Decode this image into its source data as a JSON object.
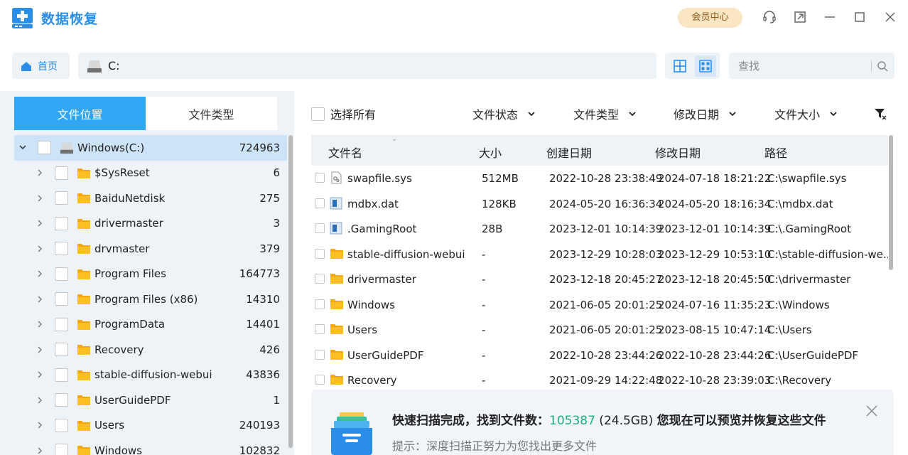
{
  "app": {
    "title": "数据恢复",
    "vip_label": "会员中心"
  },
  "nav": {
    "home_label": "首页",
    "path": "C:",
    "search_placeholder": "查找"
  },
  "left": {
    "tabs": [
      {
        "label": "文件位置",
        "active": true
      },
      {
        "label": "文件类型",
        "active": false
      }
    ],
    "tree": [
      {
        "name": "Windows(C:)",
        "count": "724963",
        "type": "drive",
        "expanded": true
      },
      {
        "name": "$SysReset",
        "count": "6",
        "type": "folder"
      },
      {
        "name": "BaiduNetdisk",
        "count": "275",
        "type": "folder"
      },
      {
        "name": "drivermaster",
        "count": "3",
        "type": "folder"
      },
      {
        "name": "drvmaster",
        "count": "379",
        "type": "folder"
      },
      {
        "name": "Program Files",
        "count": "164773",
        "type": "folder"
      },
      {
        "name": "Program Files (x86)",
        "count": "14310",
        "type": "folder"
      },
      {
        "name": "ProgramData",
        "count": "14401",
        "type": "folder"
      },
      {
        "name": "Recovery",
        "count": "426",
        "type": "folder"
      },
      {
        "name": "stable-diffusion-webui",
        "count": "43836",
        "type": "folder"
      },
      {
        "name": "UserGuidePDF",
        "count": "1",
        "type": "folder"
      },
      {
        "name": "Users",
        "count": "240193",
        "type": "folder"
      },
      {
        "name": "Windows",
        "count": "102832",
        "type": "folder"
      }
    ]
  },
  "filters": {
    "select_all": "选择所有",
    "status": "文件状态",
    "type": "文件类型",
    "modified": "修改日期",
    "size": "文件大小"
  },
  "table": {
    "headers": {
      "name": "文件名",
      "size": "大小",
      "created": "创建日期",
      "modified": "修改日期",
      "path": "路径"
    },
    "rows": [
      {
        "name": "swapfile.sys",
        "size": "512MB",
        "created": "2022-10-28 23:38:49",
        "modified": "2024-07-18 18:21:22",
        "path": "C:\\swapfile.sys",
        "icon": "sys"
      },
      {
        "name": "mdbx.dat",
        "size": "128KB",
        "created": "2024-05-20 16:36:34",
        "modified": "2024-05-20 18:16:34",
        "path": "C:\\mdbx.dat",
        "icon": "dat"
      },
      {
        "name": ".GamingRoot",
        "size": "28B",
        "created": "2023-12-01 10:14:39",
        "modified": "2023-12-01 10:14:39",
        "path": "C:\\.GamingRoot",
        "icon": "dat"
      },
      {
        "name": "stable-diffusion-webui",
        "size": "-",
        "created": "2023-12-29 10:28:03",
        "modified": "2023-12-29 10:53:10",
        "path": "C:\\stable-diffusion-we...",
        "icon": "folder"
      },
      {
        "name": "drivermaster",
        "size": "-",
        "created": "2023-12-18 20:45:27",
        "modified": "2023-12-18 20:45:50",
        "path": "C:\\drivermaster",
        "icon": "folder"
      },
      {
        "name": "Windows",
        "size": "-",
        "created": "2021-06-05 20:01:25",
        "modified": "2024-07-16 11:35:23",
        "path": "C:\\Windows",
        "icon": "folder"
      },
      {
        "name": "Users",
        "size": "-",
        "created": "2021-06-05 20:01:25",
        "modified": "2023-08-15 10:47:14",
        "path": "C:\\Users",
        "icon": "folder"
      },
      {
        "name": "UserGuidePDF",
        "size": "-",
        "created": "2022-10-28 23:44:26",
        "modified": "2022-10-28 23:44:26",
        "path": "C:\\UserGuidePDF",
        "icon": "folder"
      },
      {
        "name": "Recovery",
        "size": "-",
        "created": "2021-09-29 14:22:48",
        "modified": "2022-10-28 23:39:03",
        "path": "C:\\Recovery",
        "icon": "folder"
      }
    ]
  },
  "notice": {
    "title_prefix": "快速扫描完成，找到文件数：",
    "count": "105387",
    "size": " (24.5GB) ",
    "title_suffix": "您现在可以预览并恢复这些文件",
    "hint": "提示：深度扫描正努力为您找出更多文件"
  },
  "colors": {
    "accent": "#2fa7f5",
    "folder": "#fbbf24",
    "count_green": "#21b07c"
  }
}
